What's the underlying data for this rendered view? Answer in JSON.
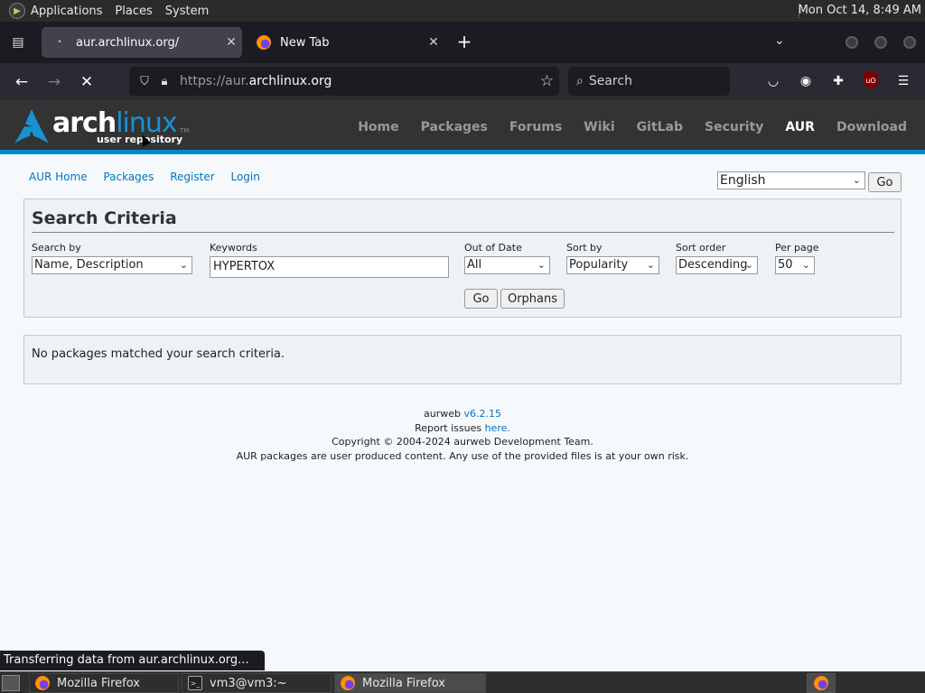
{
  "topbar": {
    "menus": [
      "Applications",
      "Places",
      "System"
    ],
    "clock": "Mon Oct 14,  8:49 AM"
  },
  "browser": {
    "tabs": [
      {
        "title": "aur.archlinux.org/",
        "active": true
      },
      {
        "title": "New Tab",
        "active": false
      }
    ],
    "url_prefix": "https://aur.",
    "url_domain": "archlinux.org",
    "search_placeholder": "Search",
    "status": "Transferring data from aur.archlinux.org..."
  },
  "arch": {
    "logo_word_bold": "arch",
    "logo_word_thin": "linux",
    "logo_sub": "user repository",
    "logo_tm": "TM",
    "nav": [
      "Home",
      "Packages",
      "Forums",
      "Wiki",
      "GitLab",
      "Security",
      "AUR",
      "Download"
    ],
    "current": "AUR"
  },
  "aur": {
    "top_links": [
      "AUR Home",
      "Packages",
      "Register",
      "Login"
    ],
    "language": "English",
    "lang_go": "Go",
    "criteria_title": "Search Criteria",
    "fields": {
      "search_by": {
        "label": "Search by",
        "value": "Name, Description"
      },
      "keywords": {
        "label": "Keywords",
        "value": "HYPERTOX"
      },
      "out_of_date": {
        "label": "Out of Date",
        "value": "All"
      },
      "sort_by": {
        "label": "Sort by",
        "value": "Popularity"
      },
      "sort_order": {
        "label": "Sort order",
        "value": "Descending"
      },
      "per_page": {
        "label": "Per page",
        "value": "50"
      }
    },
    "go_label": "Go",
    "orphans_label": "Orphans",
    "no_results": "No packages matched your search criteria."
  },
  "footer": {
    "line1_text": "aurweb ",
    "version": "v6.2.15",
    "line2_text": "Report issues ",
    "here": "here.",
    "copyright": "Copyright © 2004-2024 aurweb Development Team.",
    "disclaimer": "AUR packages are user produced content. Any use of the provided files is at your own risk."
  },
  "taskbar": {
    "items": [
      {
        "label": "Mozilla Firefox",
        "active": false
      },
      {
        "label": "vm3@vm3:~",
        "active": false
      },
      {
        "label": "Mozilla Firefox",
        "active": true
      }
    ]
  },
  "colors": {
    "arch_blue": "#1793d1",
    "link": "#0077bb",
    "header_bg": "#333333"
  }
}
